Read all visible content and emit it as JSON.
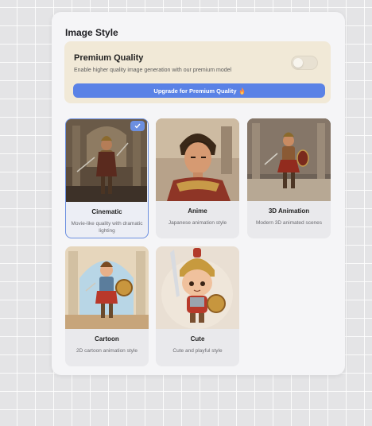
{
  "panel": {
    "title": "Image Style"
  },
  "premium": {
    "title": "Premium Quality",
    "description": "Enable higher quality image generation with our premium model",
    "toggle_on": false,
    "upgrade_label": "Upgrade for Premium Quality",
    "upgrade_icon": "flame-icon"
  },
  "styles": [
    {
      "name": "Cinematic",
      "description": "Movie-like quality with dramatic lighting",
      "selected": true
    },
    {
      "name": "Anime",
      "description": "Japanese animation style",
      "selected": false
    },
    {
      "name": "3D Animation",
      "description": "Modern 3D animated scenes",
      "selected": false
    },
    {
      "name": "Cartoon",
      "description": "2D cartoon animation style",
      "selected": false
    },
    {
      "name": "Cute",
      "description": "Cute and playful style",
      "selected": false
    }
  ],
  "colors": {
    "accent": "#5a82e6",
    "premium_bg": "#f1e9d7",
    "panel_bg": "#f5f5f7"
  }
}
